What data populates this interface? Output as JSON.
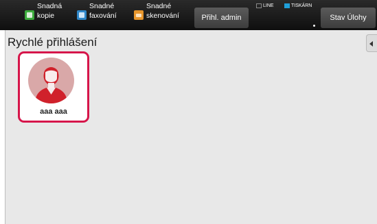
{
  "topbar": {
    "quick_buttons": [
      {
        "icon": "copy-icon",
        "line1": "Snadná",
        "line2": "kopie"
      },
      {
        "icon": "fax-icon",
        "line1": "Snadné",
        "line2": "faxování"
      },
      {
        "icon": "scan-icon",
        "line1": "Snadné",
        "line2": "skenování"
      }
    ],
    "admin_login_label": "Přihl. admin",
    "status_line_label": "LINE",
    "status_printer_label": "TISKÁRN",
    "job_status_label": "Stav Úlohy"
  },
  "main": {
    "title": "Rychlé přihlášení",
    "users": [
      {
        "name": "aaa aaa",
        "selected": true
      }
    ]
  },
  "colors": {
    "accent_selected": "#d6154a",
    "avatar_bg": "#d9a8a8",
    "avatar_figure": "#d0212b",
    "printer_status": "#1f9fd9"
  }
}
